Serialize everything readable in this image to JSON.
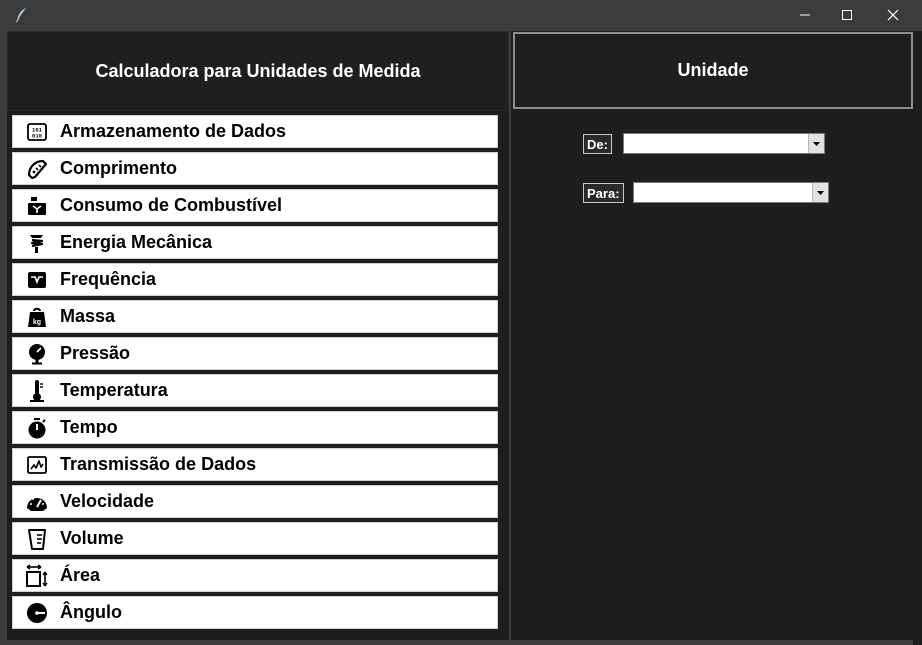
{
  "window": {
    "icon": "feather-icon",
    "controls": [
      "minimize-icon",
      "maximize-icon",
      "close-icon"
    ]
  },
  "left": {
    "title": "Calculadora para Unidades de Medida",
    "categories": [
      {
        "label": "Armazenamento de Dados",
        "icon": "binary-data-icon"
      },
      {
        "label": "Comprimento",
        "icon": "ruler-icon"
      },
      {
        "label": "Consumo de Combustível",
        "icon": "fuel-pump-icon"
      },
      {
        "label": "Energia Mecânica",
        "icon": "spring-energy-icon"
      },
      {
        "label": "Frequência",
        "icon": "frequency-box-icon"
      },
      {
        "label": "Massa",
        "icon": "kg-weight-icon"
      },
      {
        "label": "Pressão",
        "icon": "pressure-gauge-icon"
      },
      {
        "label": "Temperatura",
        "icon": "thermometer-icon"
      },
      {
        "label": "Tempo",
        "icon": "stopwatch-icon"
      },
      {
        "label": "Transmissão de Dados",
        "icon": "signal-chart-icon"
      },
      {
        "label": "Velocidade",
        "icon": "speedometer-icon"
      },
      {
        "label": "Volume",
        "icon": "measuring-cup-icon"
      },
      {
        "label": "Área",
        "icon": "area-arrows-icon"
      },
      {
        "label": "Ângulo",
        "icon": "angle-icon"
      }
    ]
  },
  "right": {
    "title": "Unidade",
    "from_label": "De:",
    "from_value": "",
    "to_label": "Para:",
    "to_value": ""
  },
  "colors": {
    "background": "#1e1e1e",
    "titlebar": "#3c3c3c",
    "item_bg": "#ffffff",
    "text_light": "#ffffff",
    "text_dark": "#000000"
  }
}
